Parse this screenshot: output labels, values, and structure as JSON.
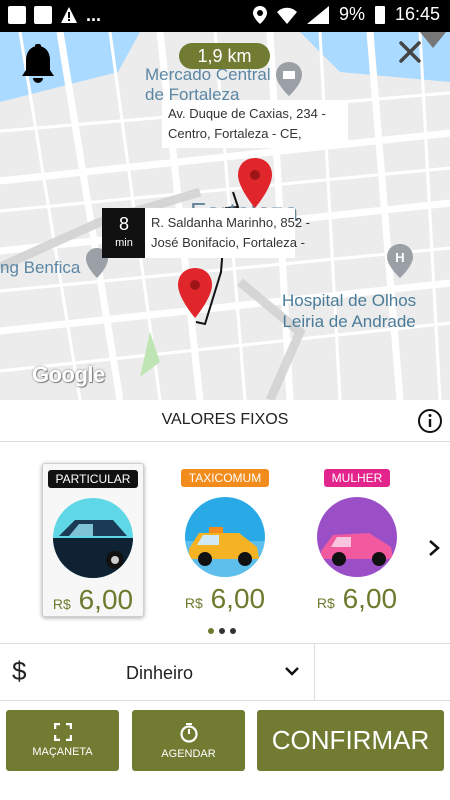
{
  "status_bar": {
    "battery": "9%",
    "time": "16:45",
    "overflow": "..."
  },
  "map": {
    "distance": "1,9 km",
    "labels": {
      "mercado": "Mercado Central\nde Fortaleza",
      "city": "Fortaleza",
      "benfica": "ng Benfica",
      "hospital": "Hospital de Olhos\nLeiria de Andrade"
    },
    "destination_address": "Av. Duque de Caxias, 234 -\nCentro, Fortaleza - CE,",
    "origin_address": "R. Saldanha Marinho, 852 -\nJosé Bonifacio, Fortaleza -",
    "eta_value": "8",
    "eta_unit": "min",
    "attribution": "Google",
    "pin_color": "#e0262b"
  },
  "section": {
    "title": "VALORES FIXOS"
  },
  "categories": [
    {
      "tag": "PARTICULAR",
      "tag_color": "#111111",
      "currency": "R$",
      "price": "6,00",
      "selected": true,
      "circle_color": "#5fd7e6",
      "car_color": "#0f2233"
    },
    {
      "tag": "TAXICOMUM",
      "tag_color": "#f28c1c",
      "currency": "R$",
      "price": "6,00",
      "selected": false,
      "circle_color": "#29a9e6",
      "car_color": "#f5b323"
    },
    {
      "tag": "MULHER",
      "tag_color": "#e3248c",
      "currency": "R$",
      "price": "6,00",
      "selected": false,
      "circle_color": "#9b4fc7",
      "car_color": "#f25aa0"
    }
  ],
  "payment": {
    "symbol": "$",
    "method": "Dinheiro"
  },
  "buttons": {
    "handle": "MAÇANETA",
    "schedule": "AGENDAR",
    "confirm": "CONFIRMAR"
  },
  "colors": {
    "accent": "#717b32",
    "price": "#6e7a2e"
  }
}
